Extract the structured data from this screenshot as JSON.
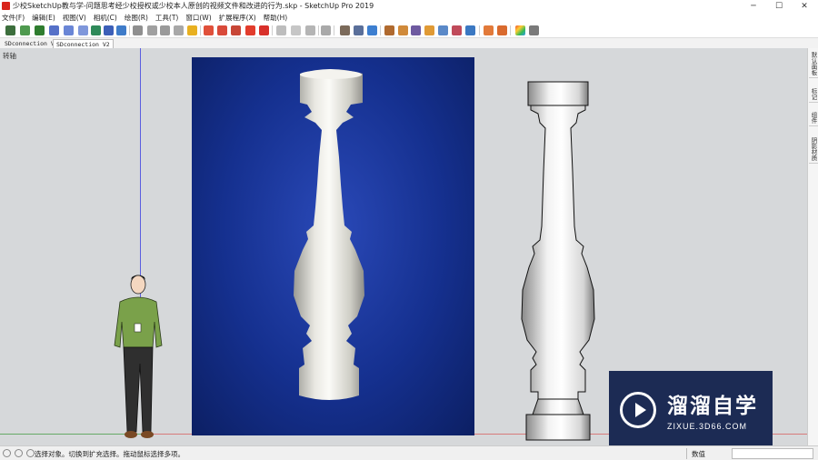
{
  "window": {
    "title": "少校SketchUp教与学-问题思考经少校授权或少校本人原创的视频文件和改进的行为.skp - SketchUp Pro 2019",
    "minimize_glyph": "─",
    "maximize_glyph": "☐",
    "close_glyph": "✕"
  },
  "menu": [
    "文件(F)",
    "编辑(E)",
    "视图(V)",
    "相机(C)",
    "绘图(R)",
    "工具(T)",
    "窗口(W)",
    "扩展程序(X)",
    "帮助(H)"
  ],
  "tabs": [
    "SDconnection V1",
    "SDconnection V2"
  ],
  "scene_label": "转轴",
  "right_panel": [
    "默认面板",
    "标记",
    "组件",
    "阴影材质"
  ],
  "watermark": {
    "title": "溜溜自学",
    "url": "ZIXUE.3D66.COM"
  },
  "status": {
    "hint": "选择对象。切换到扩充选择。拖动鼠标选择多项。",
    "measure_label": "数值",
    "measure_value": ""
  },
  "colors": {
    "photo_background": "#15308f",
    "watermark_background": "#1c2b54",
    "viewport_background": "#d6d8da"
  }
}
